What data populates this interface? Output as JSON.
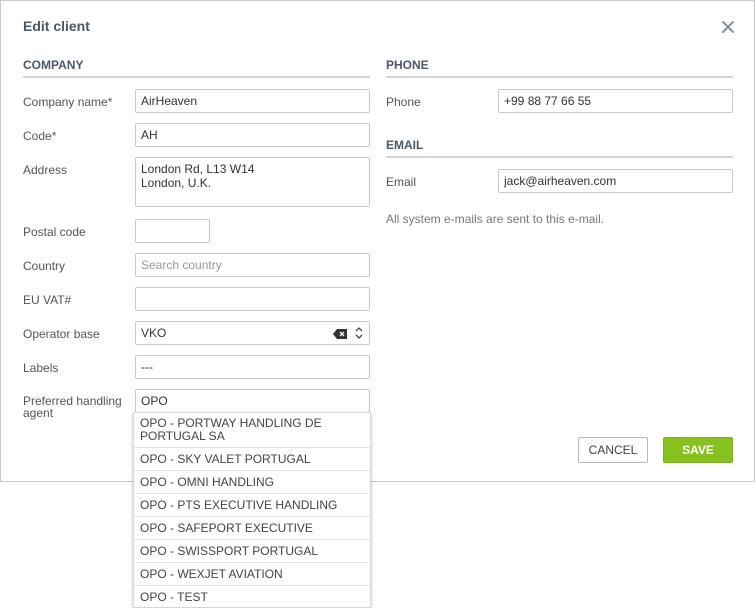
{
  "dialog": {
    "title": "Edit client"
  },
  "company": {
    "section_title": "COMPANY",
    "fields": {
      "company_name": {
        "label": "Company name*",
        "value": "AirHeaven"
      },
      "code": {
        "label": "Code*",
        "value": "AH"
      },
      "address": {
        "label": "Address",
        "line1": "London Rd, L13 W14",
        "line2": "London, U.K."
      },
      "postal_code": {
        "label": "Postal code",
        "value": ""
      },
      "country": {
        "label": "Country",
        "placeholder": "Search country"
      },
      "eu_vat": {
        "label": "EU VAT#",
        "value": ""
      },
      "operator_base": {
        "label": "Operator base",
        "value": "VKO"
      },
      "labels": {
        "label": "Labels",
        "value": "---"
      },
      "handling_agent": {
        "label_line1": "Preferred handling",
        "label_line2": "agent",
        "value": "OPO"
      }
    }
  },
  "phone": {
    "section_title": "PHONE",
    "label": "Phone",
    "value": "+99 88 77 66 55"
  },
  "email": {
    "section_title": "EMAIL",
    "label": "Email",
    "value": "jack@airheaven.com",
    "help": "All system e-mails are sent to this e-mail."
  },
  "buttons": {
    "cancel": "CANCEL",
    "save": "SAVE"
  },
  "dropdown": {
    "options": [
      {
        "line1": "OPO - PORTWAY HANDLING DE",
        "line2": "PORTUGAL SA"
      },
      {
        "line1": "OPO - SKY VALET PORTUGAL"
      },
      {
        "line1": "OPO - OMNI HANDLING"
      },
      {
        "line1": "OPO - PTS EXECUTIVE HANDLING"
      },
      {
        "line1": "OPO - SAFEPORT EXECUTIVE"
      },
      {
        "line1": "OPO - SWISSPORT PORTUGAL"
      },
      {
        "line1": "OPO - WEXJET AVIATION"
      },
      {
        "line1": "OPO - TEST"
      }
    ]
  },
  "colors": {
    "accent_green": "#86c11f",
    "title": "#4d5866",
    "section_line": "#cfd6dd"
  }
}
